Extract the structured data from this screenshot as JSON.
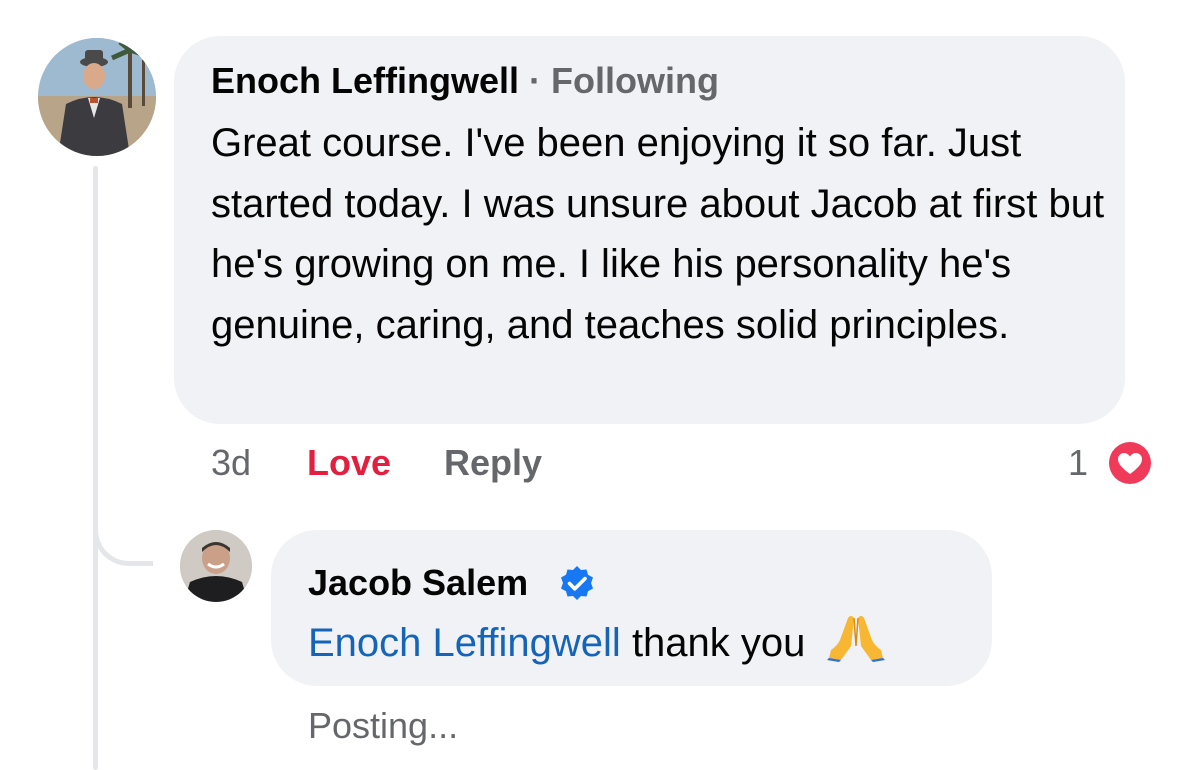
{
  "comment": {
    "author": "Enoch Leffingwell",
    "separator": "·",
    "follow_status": "Following",
    "text": "Great course. I've been enjoying it so far. Just started today. I was unsure about Jacob at first but he's growing on me. I like his personality he's genuine, caring, and teaches solid principles.",
    "time": "3d",
    "love_label": "Love",
    "reply_label": "Reply",
    "reaction_count": "1",
    "reaction_icon": "love-heart-icon",
    "avatar_icon": "profile-photo-man-hat-beach"
  },
  "reply": {
    "author": "Jacob Salem",
    "verified_icon": "verified-badge-icon",
    "mention": "Enoch Leffingwell",
    "text": "thank you",
    "emoji_icon": "folded-hands-emoji",
    "status": "Posting...",
    "avatar_icon": "profile-photo-man-smiling"
  },
  "colors": {
    "bubble": "#f0f2f5",
    "secondary_text": "#65676b",
    "love_red": "#e41e3f",
    "mention_blue": "#1664b8",
    "verified_blue": "#1877f2"
  }
}
